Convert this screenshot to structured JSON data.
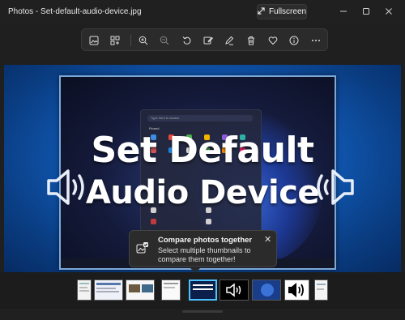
{
  "window": {
    "title": "Photos - Set-default-audio-device.jpg",
    "fullscreen_label": "Fullscreen",
    "controls": [
      "minimize",
      "maximize",
      "close"
    ]
  },
  "toolbar": {
    "buttons": [
      {
        "name": "image-info-icon"
      },
      {
        "name": "view-all-icon"
      },
      {
        "name": "zoom-in-icon"
      },
      {
        "name": "zoom-out-icon"
      },
      {
        "name": "rotate-icon"
      },
      {
        "name": "edit-image-icon"
      },
      {
        "name": "markup-icon"
      },
      {
        "name": "delete-icon"
      },
      {
        "name": "favorite-icon"
      },
      {
        "name": "info-icon"
      },
      {
        "name": "more-icon"
      }
    ]
  },
  "image": {
    "headline_line1": "Set Default",
    "headline_line2": "Audio Device",
    "start_search_placeholder": "Type here to search",
    "pinned_label": "Pinned"
  },
  "tooltip": {
    "title": "Compare photos together",
    "description": "Select multiple thumbnails to compare them together!",
    "close_glyph": "✕"
  },
  "colors": {
    "accent": "#4cc2ff",
    "canvas_blue": "#0d4aa0",
    "window_bg": "#1f1f1f"
  }
}
